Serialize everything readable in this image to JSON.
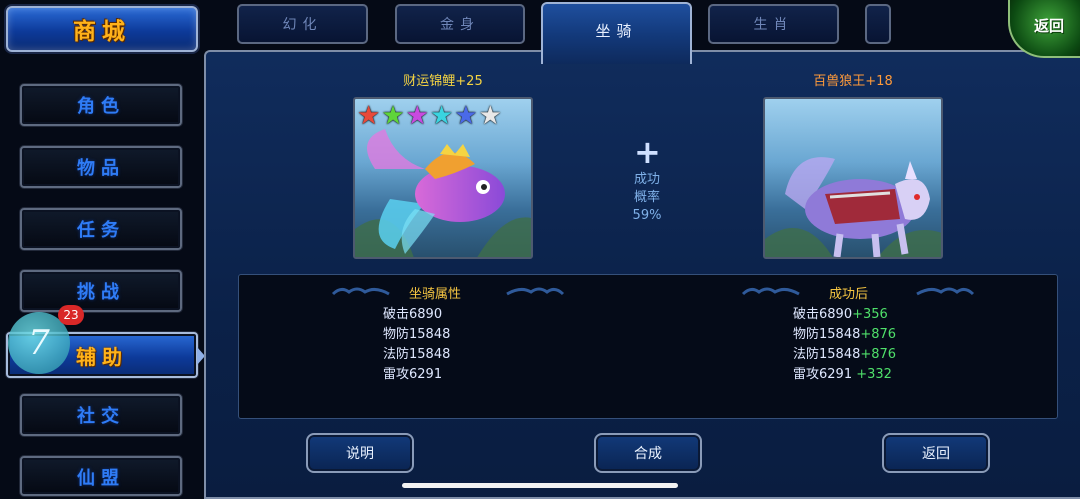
{
  "sidebar": {
    "shop_label": "商城",
    "items": [
      {
        "label": "角色",
        "active": false
      },
      {
        "label": "物品",
        "active": false
      },
      {
        "label": "任务",
        "active": false
      },
      {
        "label": "挑战",
        "active": false
      },
      {
        "label": "辅助",
        "active": true
      },
      {
        "label": "社交",
        "active": false
      },
      {
        "label": "仙盟",
        "active": false
      }
    ],
    "assist_bubble_glyph": "7",
    "notification_count": "23"
  },
  "tabs": [
    {
      "label": "幻化",
      "active": false
    },
    {
      "label": "金身",
      "active": false
    },
    {
      "label": "坐骑",
      "active": true
    },
    {
      "label": "生肖",
      "active": false
    },
    {
      "label": "",
      "active": false
    }
  ],
  "back_top_label": "返回",
  "left_mount": {
    "name": "财运锦鲤+25",
    "name_color": "#f5d442",
    "stars": [
      "#e84a3a",
      "#5fd43a",
      "#c84ae0",
      "#3ad4e0",
      "#4a6ae8",
      "#e8e8e8"
    ],
    "image_icon": "goldfish-mount"
  },
  "right_mount": {
    "name": "百兽狼王+18",
    "name_color": "#ff9a3a",
    "image_icon": "wolf-king-mount"
  },
  "merge": {
    "plus_glyph": "+",
    "success_line1": "成功",
    "success_line2": "概率",
    "rate": "59%"
  },
  "attributes": {
    "left_header": "坐骑属性",
    "right_header": "成功后",
    "current": [
      "破击6890",
      "物防15848",
      "法防15848",
      "雷攻6291"
    ],
    "after": [
      {
        "base": "破击6890",
        "bonus": "+356"
      },
      {
        "base": "物防15848",
        "bonus": "+876"
      },
      {
        "base": "法防15848",
        "bonus": "+876"
      },
      {
        "base": "雷攻6291 ",
        "bonus": "+332"
      }
    ]
  },
  "buttons": {
    "help": "说明",
    "combine": "合成",
    "back": "返回"
  }
}
